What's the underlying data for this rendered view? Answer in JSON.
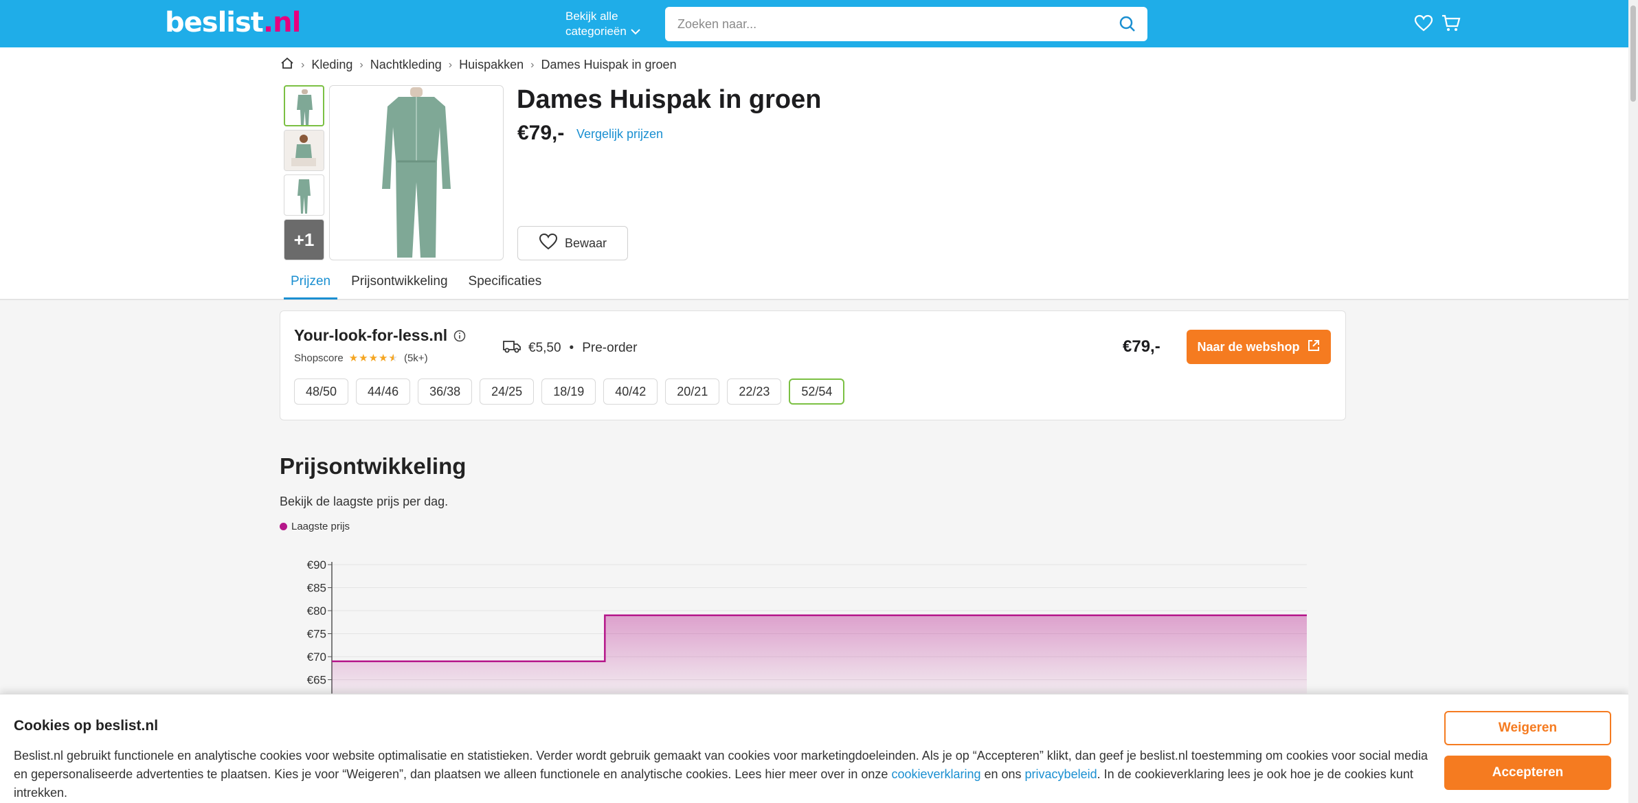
{
  "header": {
    "logo_main": "beslist",
    "logo_dot": ".",
    "logo_tld": "nl",
    "categories_line1": "Bekijk alle",
    "categories_line2": "categorieën",
    "search_placeholder": "Zoeken naar..."
  },
  "breadcrumb": {
    "items": [
      "Kleding",
      "Nachtkleding",
      "Huispakken",
      "Dames Huispak in groen"
    ]
  },
  "product": {
    "title": "Dames Huispak in groen",
    "price": "€79,-",
    "compare_label": "Vergelijk prijzen",
    "save_label": "Bewaar",
    "more_images_label": "+1"
  },
  "tabs": [
    "Prijzen",
    "Prijsontwikkeling",
    "Specificaties"
  ],
  "offer": {
    "shop_name": "Your-look-for-less.nl",
    "shopscore_label": "Shopscore",
    "rating": 4.5,
    "review_count": "(5k+)",
    "shipping_cost": "€5,50",
    "bullet": "•",
    "availability": "Pre-order",
    "price": "€79,-",
    "webshop_label": "Naar de webshop",
    "sizes": [
      "48/50",
      "44/46",
      "36/38",
      "24/25",
      "18/19",
      "40/42",
      "20/21",
      "22/23",
      "52/54"
    ],
    "selected_size": "52/54"
  },
  "price_history": {
    "title": "Prijsontwikkeling",
    "subtitle": "Bekijk de laagste prijs per dag.",
    "legend_label": "Laagste prijs"
  },
  "chart_data": {
    "type": "area",
    "series": [
      {
        "name": "Laagste prijs",
        "values": [
          69,
          69,
          79,
          79,
          79,
          79,
          79,
          79,
          79,
          79,
          79,
          79,
          79,
          79
        ]
      }
    ],
    "y_ticks": [
      "€90",
      "€85",
      "€80",
      "€75",
      "€70",
      "€65"
    ],
    "ylim": [
      62,
      90
    ],
    "step_fraction": 0.28,
    "grid": true,
    "color": "#b5178a"
  },
  "cookie": {
    "title": "Cookies op beslist.nl",
    "text_part1": "Beslist.nl gebruikt functionele en analytische cookies voor website optimalisatie en statistieken. Verder wordt gebruik gemaakt van cookies voor marketingdoeleinden. Als je op “Accepteren” klikt, dan geef je beslist.nl toestemming om cookies voor social media en gepersonaliseerde advertenties te plaatsen. Kies je voor “Weigeren”, dan plaatsen we alleen functionele en analytische cookies. Lees hier meer over in onze ",
    "link1": "cookieverklaring",
    "text_part2": " en ons ",
    "link2": "privacybeleid",
    "text_part3": ". In de cookieverklaring lees je ook hoe je de cookies kunt intrekken.",
    "refuse_label": "Weigeren",
    "accept_label": "Accepteren"
  },
  "colors": {
    "header_bg": "#1fade8",
    "accent_orange": "#f57b20",
    "link_blue": "#1a8fd1",
    "chart_magenta": "#b5178a",
    "selected_green": "#7bc043"
  }
}
